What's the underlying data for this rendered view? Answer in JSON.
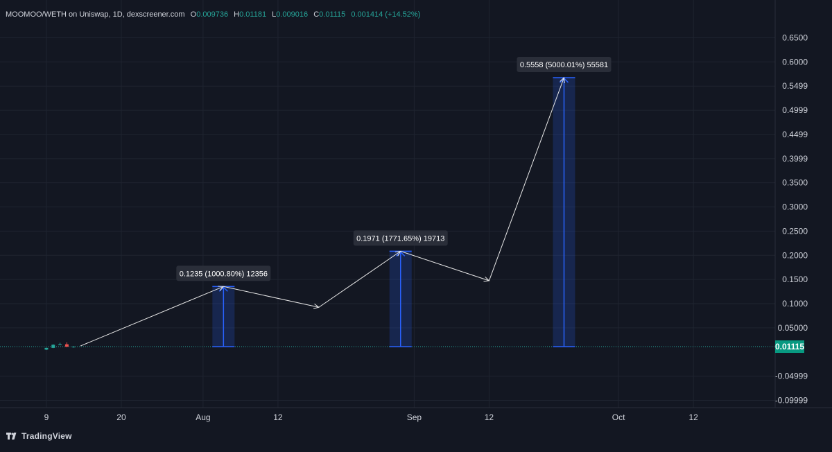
{
  "legend": {
    "pair": "MOOMOO/WETH on Uniswap, 1D, dexscreener.com",
    "open_label": "O",
    "open": "0.009736",
    "high_label": "H",
    "high": "0.01181",
    "low_label": "L",
    "low": "0.009016",
    "close_label": "C",
    "close": "0.01115",
    "change": "0.001414 (+14.52%)"
  },
  "branding": {
    "text": "TradingView"
  },
  "colors": {
    "background": "#131722",
    "grid": "#1f2430",
    "up": "#26a69a",
    "down": "#ef5350",
    "measure_line": "#2962ff",
    "price_badge": "#089981"
  },
  "chart_data": {
    "type": "candlestick",
    "title": "MOOMOO/WETH on Uniswap, 1D, dexscreener.com",
    "y_range": [
      -0.115,
      0.685
    ],
    "x_range": [
      "2024-07-03",
      "2024-10-24"
    ],
    "grid": true,
    "y_ticks": [
      "0.6500",
      "0.6000",
      "0.5499",
      "0.4999",
      "0.4499",
      "0.3999",
      "0.3500",
      "0.3000",
      "0.2500",
      "0.2000",
      "0.1500",
      "0.1000",
      "0.05000",
      "0.01115",
      "-0.04999",
      "-0.09999"
    ],
    "y_tick_values": [
      0.65,
      0.6,
      0.5499,
      0.4999,
      0.4499,
      0.3999,
      0.35,
      0.3,
      0.25,
      0.2,
      0.15,
      0.1,
      0.05,
      0.01115,
      -0.04999,
      -0.09999
    ],
    "x_ticks": [
      {
        "label": "9",
        "date": "2024-07-09"
      },
      {
        "label": "20",
        "date": "2024-07-20"
      },
      {
        "label": "Aug",
        "date": "2024-08-01"
      },
      {
        "label": "12",
        "date": "2024-08-12"
      },
      {
        "label": "Sep",
        "date": "2024-09-01"
      },
      {
        "label": "12",
        "date": "2024-09-12"
      },
      {
        "label": "Oct",
        "date": "2024-10-01"
      },
      {
        "label": "12",
        "date": "2024-10-12"
      }
    ],
    "candles": [
      {
        "date": "2024-07-09",
        "open": 0.005,
        "high": 0.009,
        "low": 0.004,
        "close": 0.0085
      },
      {
        "date": "2024-07-10",
        "open": 0.0085,
        "high": 0.016,
        "low": 0.008,
        "close": 0.015
      },
      {
        "date": "2024-07-11",
        "open": 0.015,
        "high": 0.019,
        "low": 0.014,
        "close": 0.016
      },
      {
        "date": "2024-07-12",
        "open": 0.016,
        "high": 0.02,
        "low": 0.01,
        "close": 0.011
      },
      {
        "date": "2024-07-13",
        "open": 0.009736,
        "high": 0.01181,
        "low": 0.009016,
        "close": 0.01115
      }
    ],
    "current_price": "0.01115",
    "current_price_value": 0.01115,
    "measures": [
      {
        "label": "0.1235 (1000.80%) 12356",
        "date": "2024-08-04",
        "from": 0.01115,
        "to": 0.1355
      },
      {
        "label": "0.1971 (1771.65%) 19713",
        "date": "2024-08-30",
        "from": 0.01115,
        "to": 0.2085
      },
      {
        "label": "0.5558 (5000.01%) 55581",
        "date": "2024-09-23",
        "from": 0.01115,
        "to": 0.5675
      }
    ],
    "path": [
      {
        "date": "2024-07-14",
        "value": 0.0125
      },
      {
        "date": "2024-08-04",
        "value": 0.1355
      },
      {
        "date": "2024-08-18",
        "value": 0.0925
      },
      {
        "date": "2024-08-30",
        "value": 0.2085
      },
      {
        "date": "2024-09-12",
        "value": 0.1475
      },
      {
        "date": "2024-09-23",
        "value": 0.5675
      }
    ]
  }
}
